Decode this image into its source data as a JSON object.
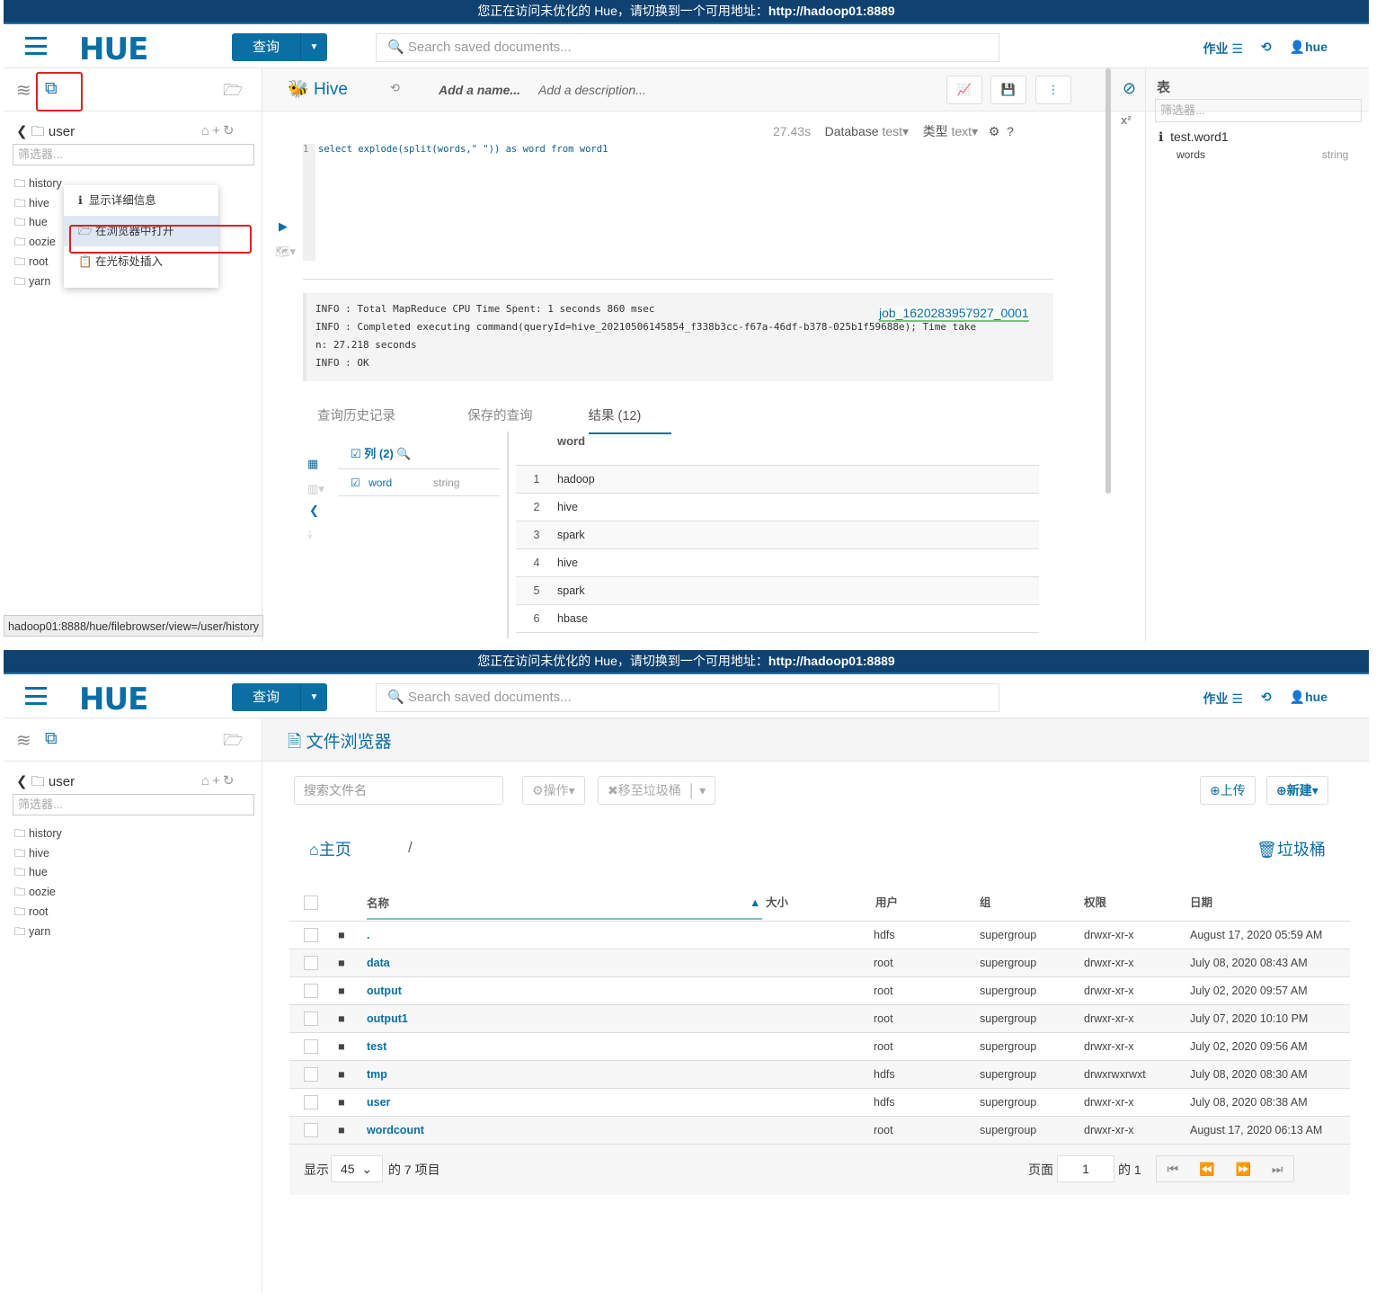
{
  "header": {
    "banner_text": "您正在访问未优化的 Hue，请切换到一个可用地址：",
    "banner_url": "http://hadoop01:8889",
    "logo": "HUE",
    "query_button": "查询",
    "search_placeholder": "Search saved documents...",
    "jobs": "作业",
    "user": "hue"
  },
  "sidebar": {
    "path": "user",
    "filter_placeholder": "筛选器...",
    "items": [
      "history",
      "hive",
      "hue",
      "oozie",
      "root",
      "yarn"
    ]
  },
  "top": {
    "context_menu": [
      "显示详细信息",
      "在浏览器中打开",
      "在光标处插入"
    ],
    "editor": {
      "engine": "Hive",
      "name_placeholder": "Add a name...",
      "desc_placeholder": "Add a description...",
      "elapsed": "27.43s",
      "database_label": "Database",
      "database": "test",
      "type_label": "类型",
      "type": "text",
      "line_no": "1",
      "query": "select explode(split(words,\" \")) as word from word1"
    },
    "log": [
      "INFO  : Total MapReduce CPU Time Spent: 1 seconds 860 msec",
      "INFO  : Completed executing command(queryId=hive_20210506145854_f338b3cc-f67a-46df-b378-025b1f59688e); Time take",
      "n: 27.218 seconds",
      "INFO  : OK"
    ],
    "job_link": "job_1620283957927_0001",
    "tabs": [
      "查询历史记录",
      "保存的查询",
      "结果 (12)"
    ],
    "columns_header": "列 (2)",
    "column": {
      "name": "word",
      "type": "string"
    },
    "result_header": "word",
    "results": [
      "hadoop",
      "hive",
      "spark",
      "hive",
      "spark",
      "hbase"
    ],
    "assist": {
      "title": "表",
      "filter_placeholder": "筛选器...",
      "table": "test.word1",
      "column": "words",
      "column_type": "string"
    },
    "status_url": "hadoop01:8888/hue/filebrowser/view=/user/history"
  },
  "bottom": {
    "title": "文件浏览器",
    "search_placeholder": "搜索文件名",
    "actions": "操作",
    "trash_move": "移至垃圾桶",
    "upload": "上传",
    "new": "新建",
    "home": "主页",
    "sep": "/",
    "trash": "垃圾桶",
    "headers": [
      "名称",
      "大小",
      "用户",
      "组",
      "权限",
      "日期"
    ],
    "rows": [
      [
        ".",
        "hdfs",
        "supergroup",
        "drwxr-xr-x",
        "August 17, 2020 05:59 AM"
      ],
      [
        "data",
        "root",
        "supergroup",
        "drwxr-xr-x",
        "July 08, 2020 08:43 AM"
      ],
      [
        "output",
        "root",
        "supergroup",
        "drwxr-xr-x",
        "July 02, 2020 09:57 AM"
      ],
      [
        "output1",
        "root",
        "supergroup",
        "drwxr-xr-x",
        "July 07, 2020 10:10 PM"
      ],
      [
        "test",
        "root",
        "supergroup",
        "drwxr-xr-x",
        "July 02, 2020 09:56 AM"
      ],
      [
        "tmp",
        "hdfs",
        "supergroup",
        "drwxrwxrwxt",
        "July 08, 2020 08:30 AM"
      ],
      [
        "user",
        "hdfs",
        "supergroup",
        "drwxr-xr-x",
        "July 08, 2020 08:38 AM"
      ],
      [
        "wordcount",
        "root",
        "supergroup",
        "drwxr-xr-x",
        "August 17, 2020 06:13 AM"
      ]
    ],
    "show_label": "显示",
    "page_size": "45",
    "total": "的 7 项目",
    "page_label": "页面",
    "page": "1",
    "page_of": "的 1"
  },
  "colors": {
    "banner": "#0f4271",
    "accent": "#0b6fa4",
    "highlight_box": "#e02020"
  }
}
